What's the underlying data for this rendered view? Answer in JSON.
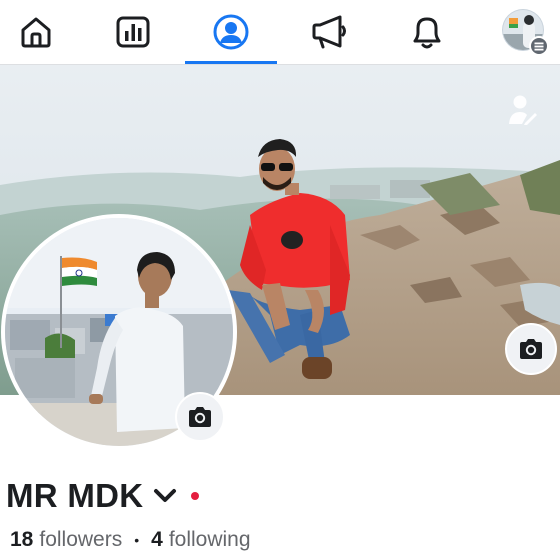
{
  "colors": {
    "accent": "#1877f2",
    "icon": "#1c1e21",
    "status_dot": "#e41e3f"
  },
  "nav": {
    "items": [
      {
        "icon": "home-icon",
        "active": false
      },
      {
        "icon": "feeds-icon",
        "active": false
      },
      {
        "icon": "profile-icon",
        "active": true
      },
      {
        "icon": "megaphone-icon",
        "active": false
      },
      {
        "icon": "bell-icon",
        "active": false
      },
      {
        "icon": "menu-avatar-icon",
        "active": false
      }
    ]
  },
  "cover": {
    "camera_icon": "camera-icon",
    "edit_icon": "person-edit-icon"
  },
  "profile": {
    "name": "MR MDK",
    "followers_count": "18",
    "followers_label": "followers",
    "separator": "•",
    "following_count": "4",
    "following_label": "following"
  }
}
